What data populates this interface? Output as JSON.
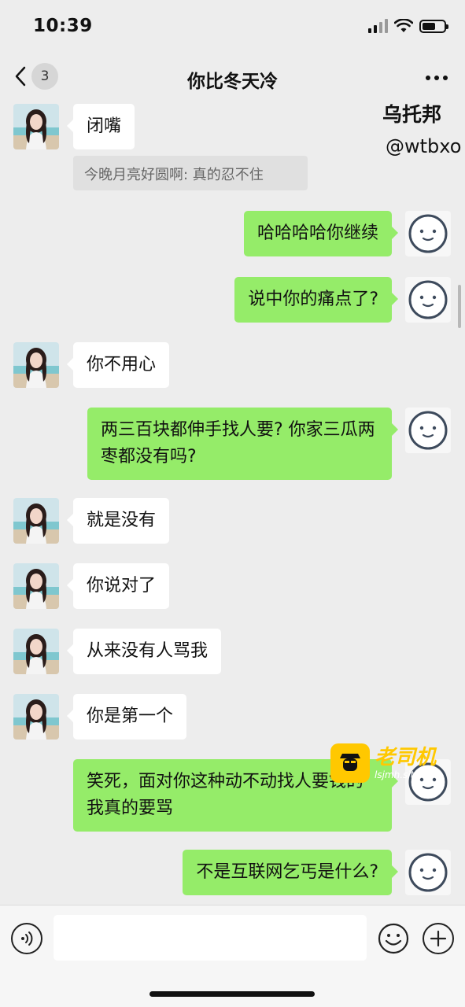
{
  "status_bar": {
    "time": "10:39",
    "battery_level": 0.6
  },
  "nav": {
    "back_count": "3",
    "title": "你比冬天冷"
  },
  "watermark": {
    "name": "乌托邦",
    "handle": "@wtbxo"
  },
  "logo": {
    "main": "老司机",
    "sub": "lsjmh.site"
  },
  "quote": {
    "text": "今晚月亮好圆啊: 真的忍不住"
  },
  "messages": [
    {
      "from": "other",
      "text": "闭嘴"
    },
    {
      "from": "me",
      "text": "哈哈哈哈你继续"
    },
    {
      "from": "me",
      "text": "说中你的痛点了?"
    },
    {
      "from": "other",
      "text": "你不用心"
    },
    {
      "from": "me",
      "text": "两三百块都伸手找人要? 你家三瓜两枣都没有吗?"
    },
    {
      "from": "other",
      "text": "就是没有"
    },
    {
      "from": "other",
      "text": "你说对了"
    },
    {
      "from": "other",
      "text": "从来没有人骂我"
    },
    {
      "from": "other",
      "text": "你是第一个"
    },
    {
      "from": "me",
      "text": "笑死，面对你这种动不动找人要钱的我真的要骂"
    },
    {
      "from": "me",
      "text": "不是互联网乞丐是什么?"
    }
  ],
  "input": {
    "value": "",
    "placeholder": ""
  },
  "colors": {
    "background": "#ededed",
    "bubble_me": "#95ec69",
    "bubble_other": "#ffffff",
    "logo": "#ffc800"
  },
  "icons": [
    "chevron-left-icon",
    "more-icon",
    "voice-icon",
    "emoji-icon",
    "plus-icon",
    "smiley-avatar-icon"
  ]
}
